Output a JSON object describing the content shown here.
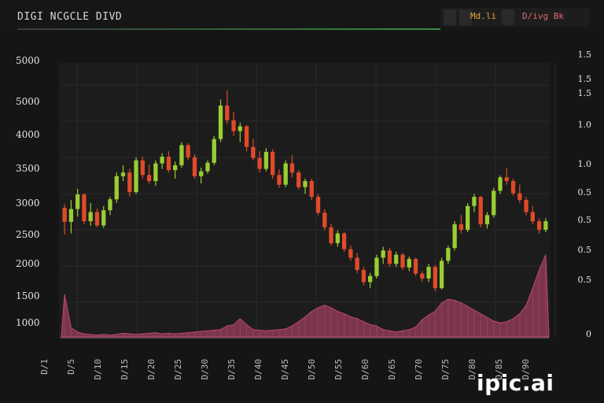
{
  "header": {
    "title": "DIGI NCGCLE DIVD",
    "right_label_1": "Md.li",
    "right_label_2": "D/ivg Bk"
  },
  "watermark": "ipic.ai",
  "colors": {
    "background": "#151515",
    "plot_background": "#1c1c1c",
    "grid": "#2a2a2a",
    "candle_up": "#9acd32",
    "candle_down": "#e04a2a",
    "volume_fill": "#8a3a55",
    "volume_stroke": "#c04a6a"
  },
  "chart_data": {
    "type": "candlestick",
    "grid": true,
    "y_left_ticks": [
      "5000",
      "5000",
      "4000",
      "3500",
      "3000",
      "2500",
      "2000",
      "1500",
      "1000"
    ],
    "y_right_ticks": [
      "1.5",
      "1.5",
      "1.5",
      "1.0",
      "1.0",
      "0.5",
      "0.5",
      "0.5",
      "0.5",
      "0"
    ],
    "ylim": [
      1000,
      5500
    ],
    "x_ticks": [
      "D/1",
      "D/5",
      "D/10",
      "D/15",
      "D/20",
      "D/25",
      "D/30",
      "D/35",
      "D/40",
      "D/45",
      "D/50",
      "D/55",
      "D/60",
      "D/65",
      "D/70",
      "D/75",
      "D/80",
      "D/85",
      "D/90"
    ],
    "candles": [
      [
        3120,
        3180,
        2680,
        2890
      ],
      [
        2890,
        3250,
        2700,
        3100
      ],
      [
        3100,
        3430,
        2980,
        3340
      ],
      [
        3340,
        3360,
        2850,
        2900
      ],
      [
        2900,
        3200,
        2820,
        3050
      ],
      [
        3050,
        3110,
        2800,
        2830
      ],
      [
        2830,
        3150,
        2790,
        3080
      ],
      [
        3080,
        3300,
        3000,
        3260
      ],
      [
        3260,
        3700,
        3200,
        3640
      ],
      [
        3640,
        3820,
        3560,
        3700
      ],
      [
        3700,
        3760,
        3300,
        3380
      ],
      [
        3380,
        3950,
        3350,
        3900
      ],
      [
        3900,
        3960,
        3600,
        3660
      ],
      [
        3660,
        3830,
        3520,
        3560
      ],
      [
        3560,
        3900,
        3480,
        3850
      ],
      [
        3850,
        4020,
        3760,
        3960
      ],
      [
        3960,
        4050,
        3700,
        3740
      ],
      [
        3740,
        3880,
        3600,
        3820
      ],
      [
        3820,
        4200,
        3780,
        4150
      ],
      [
        4150,
        4180,
        3900,
        3950
      ],
      [
        3950,
        4000,
        3600,
        3640
      ],
      [
        3640,
        3780,
        3520,
        3720
      ],
      [
        3720,
        3900,
        3680,
        3860
      ],
      [
        3860,
        4300,
        3820,
        4250
      ],
      [
        4250,
        4900,
        4200,
        4800
      ],
      [
        4800,
        5050,
        4500,
        4560
      ],
      [
        4560,
        4700,
        4300,
        4380
      ],
      [
        4380,
        4520,
        4200,
        4460
      ],
      [
        4460,
        4480,
        4050,
        4120
      ],
      [
        4120,
        4250,
        3900,
        3940
      ],
      [
        3940,
        4050,
        3700,
        3760
      ],
      [
        3760,
        4100,
        3720,
        4040
      ],
      [
        4040,
        4080,
        3600,
        3660
      ],
      [
        3660,
        3750,
        3450,
        3500
      ],
      [
        3500,
        3900,
        3460,
        3850
      ],
      [
        3850,
        3980,
        3620,
        3700
      ],
      [
        3700,
        3740,
        3420,
        3460
      ],
      [
        3460,
        3600,
        3350,
        3560
      ],
      [
        3560,
        3600,
        3250,
        3300
      ],
      [
        3300,
        3350,
        3000,
        3040
      ],
      [
        3040,
        3100,
        2750,
        2800
      ],
      [
        2800,
        2860,
        2500,
        2540
      ],
      [
        2540,
        2750,
        2480,
        2700
      ],
      [
        2700,
        2720,
        2400,
        2440
      ],
      [
        2440,
        2500,
        2250,
        2300
      ],
      [
        2300,
        2380,
        2050,
        2100
      ],
      [
        2100,
        2150,
        1850,
        1900
      ],
      [
        1900,
        2050,
        1800,
        2000
      ],
      [
        2000,
        2350,
        1960,
        2300
      ],
      [
        2300,
        2480,
        2200,
        2420
      ],
      [
        2420,
        2460,
        2150,
        2200
      ],
      [
        2200,
        2400,
        2150,
        2350
      ],
      [
        2350,
        2380,
        2100,
        2140
      ],
      [
        2140,
        2320,
        2080,
        2280
      ],
      [
        2280,
        2300,
        2000,
        2040
      ],
      [
        2040,
        2080,
        1900,
        1960
      ],
      [
        1960,
        2200,
        1900,
        2150
      ],
      [
        2150,
        2180,
        1750,
        1800
      ],
      [
        1800,
        2300,
        1780,
        2250
      ],
      [
        2250,
        2500,
        2200,
        2460
      ],
      [
        2460,
        2900,
        2420,
        2850
      ],
      [
        2850,
        3000,
        2700,
        2760
      ],
      [
        2760,
        3200,
        2720,
        3150
      ],
      [
        3150,
        3350,
        3050,
        3300
      ],
      [
        3300,
        3320,
        2800,
        2850
      ],
      [
        2850,
        3050,
        2780,
        3000
      ],
      [
        3000,
        3450,
        2960,
        3400
      ],
      [
        3400,
        3650,
        3350,
        3620
      ],
      [
        3620,
        3780,
        3500,
        3560
      ],
      [
        3560,
        3600,
        3320,
        3360
      ],
      [
        3360,
        3500,
        3200,
        3250
      ],
      [
        3250,
        3300,
        3000,
        3050
      ],
      [
        3050,
        3150,
        2850,
        2900
      ],
      [
        2900,
        2950,
        2700,
        2760
      ],
      [
        2760,
        2950,
        2720,
        2900
      ]
    ],
    "volume": [
      1700,
      1150,
      1080,
      1050,
      1040,
      1030,
      1040,
      1030,
      1040,
      1060,
      1050,
      1040,
      1050,
      1060,
      1070,
      1050,
      1060,
      1050,
      1060,
      1070,
      1080,
      1090,
      1100,
      1110,
      1120,
      1180,
      1200,
      1300,
      1200,
      1120,
      1110,
      1100,
      1110,
      1120,
      1130,
      1180,
      1250,
      1330,
      1420,
      1480,
      1520,
      1480,
      1420,
      1380,
      1330,
      1300,
      1250,
      1200,
      1180,
      1120,
      1100,
      1080,
      1100,
      1120,
      1160,
      1280,
      1360,
      1420,
      1560,
      1620,
      1600,
      1560,
      1500,
      1440,
      1380,
      1320,
      1260,
      1230,
      1250,
      1300,
      1380,
      1520,
      1800,
      2100,
      2350
    ]
  }
}
